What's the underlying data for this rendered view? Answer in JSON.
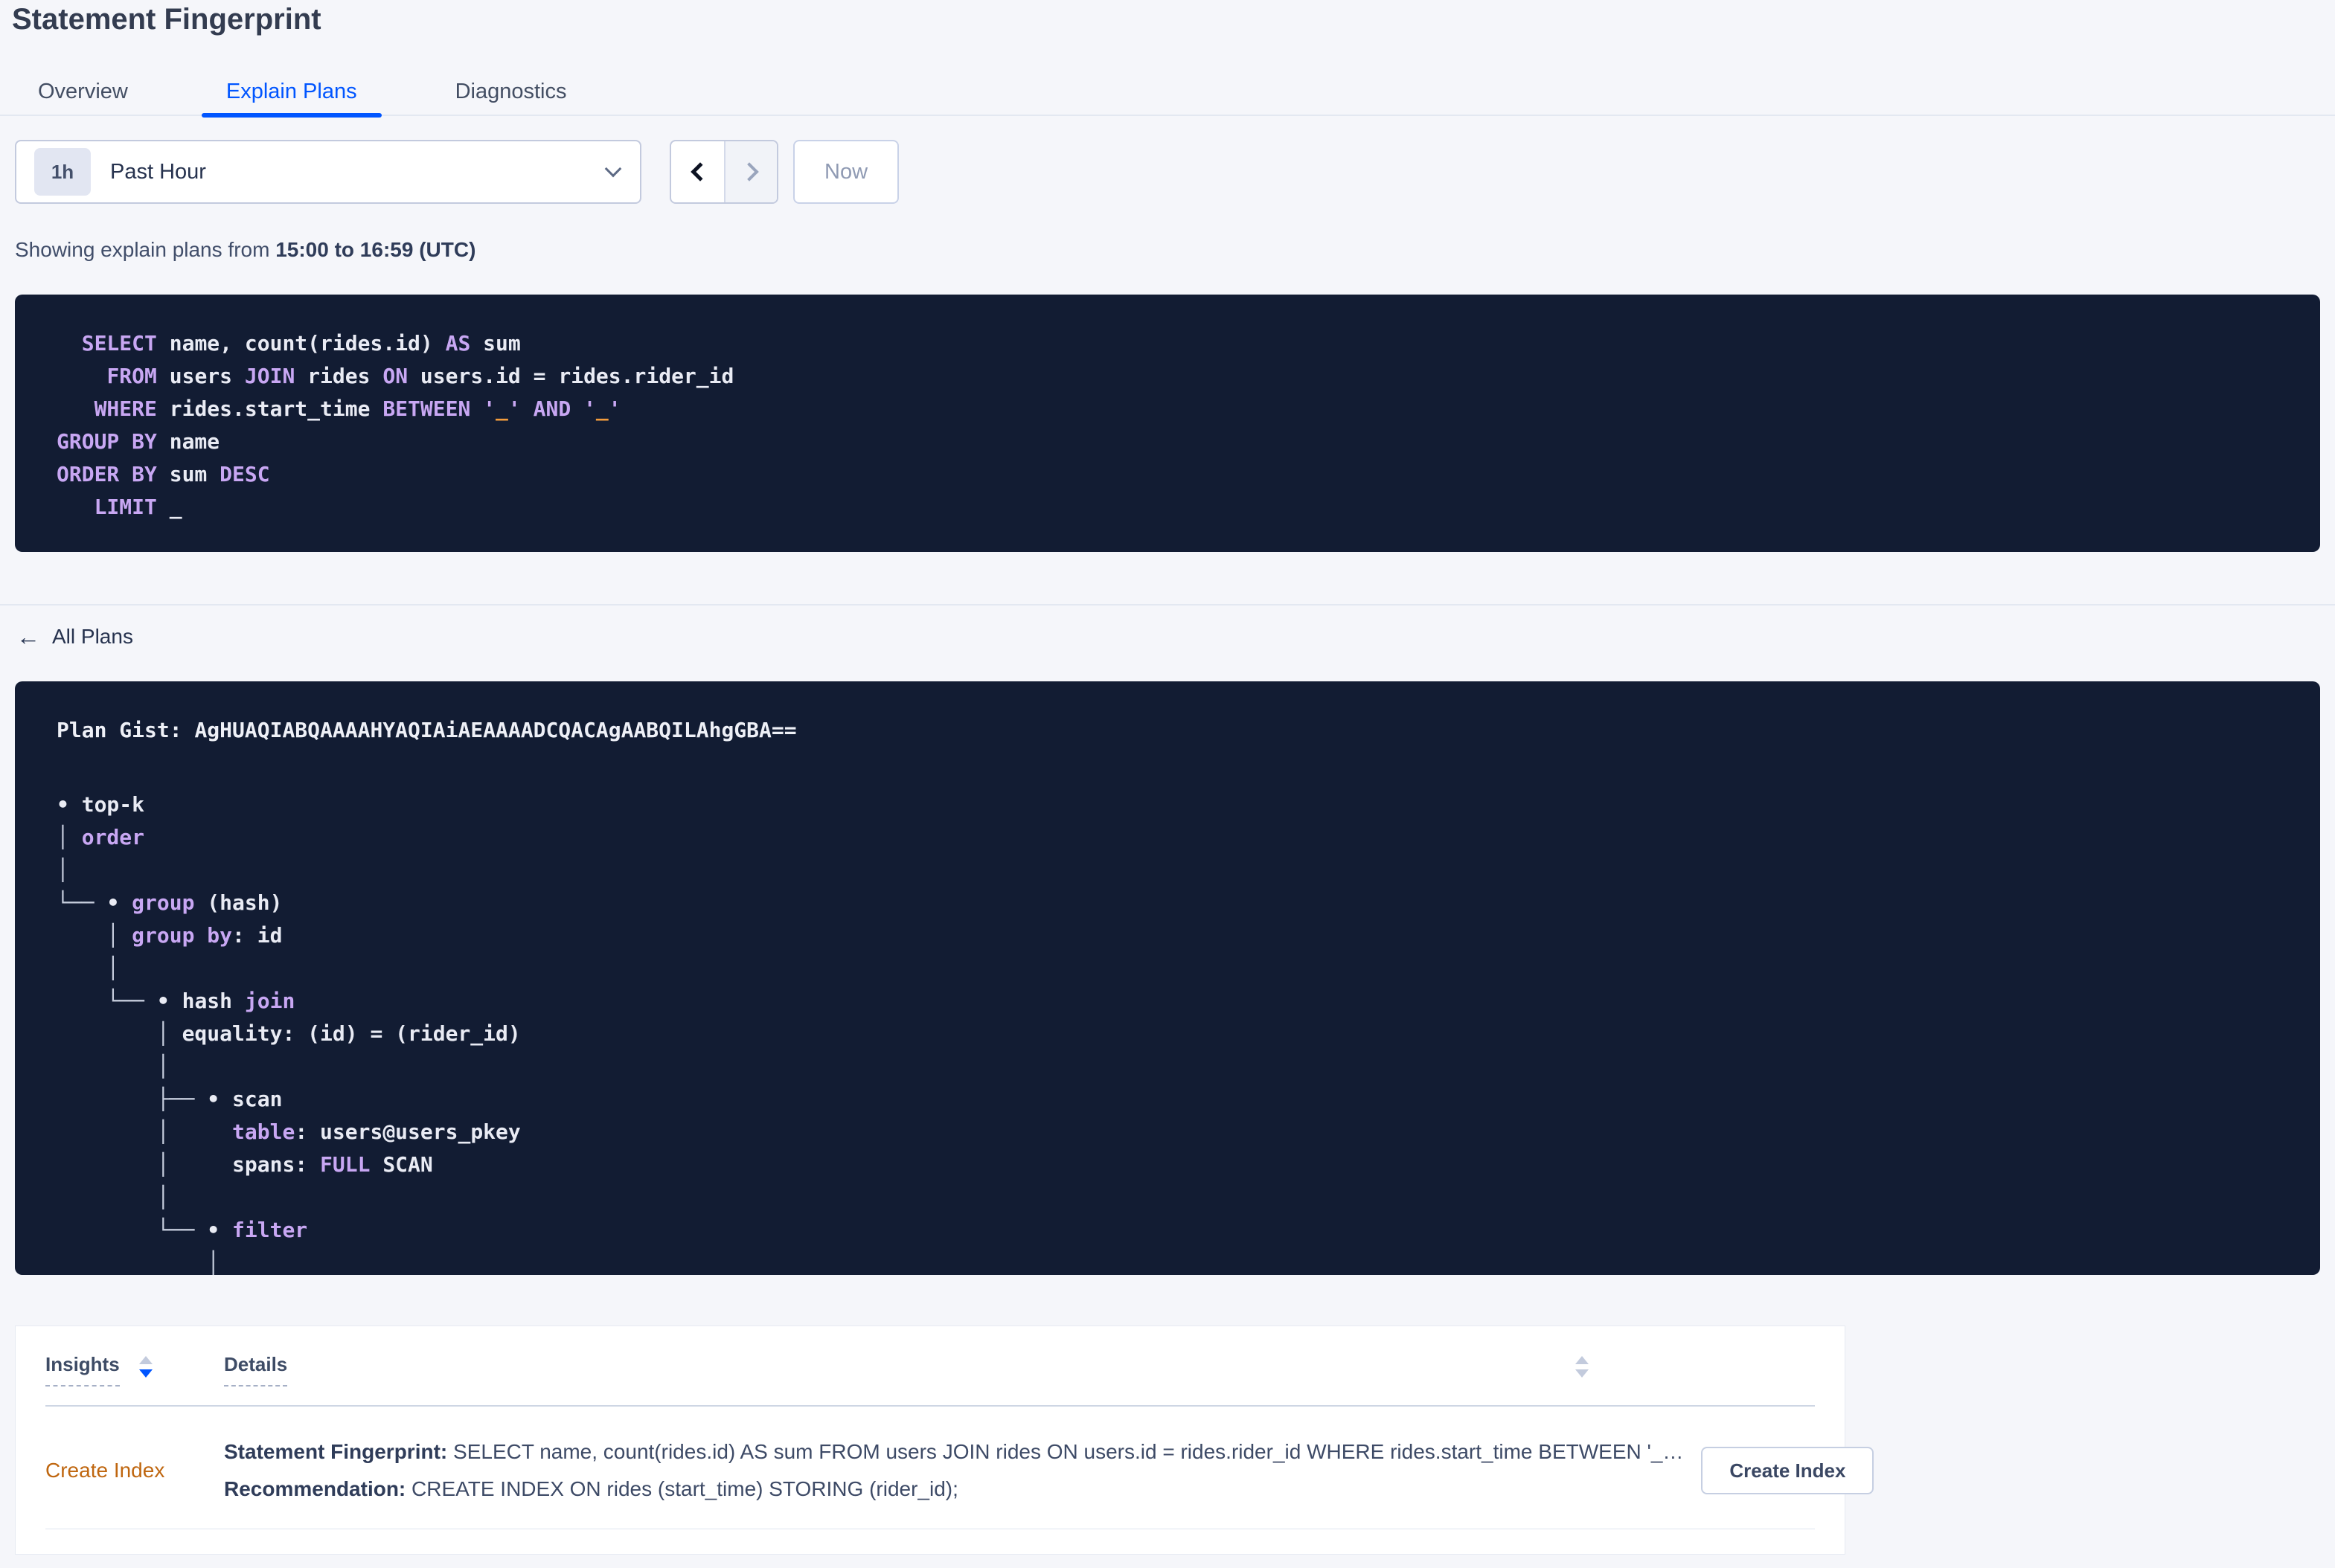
{
  "page": {
    "title": "Statement Fingerprint"
  },
  "tabs": [
    {
      "label": "Overview",
      "active": false
    },
    {
      "label": "Explain Plans",
      "active": true
    },
    {
      "label": "Diagnostics",
      "active": false
    }
  ],
  "time_selector": {
    "badge": "1h",
    "label": "Past Hour",
    "now_label": "Now"
  },
  "subtitle": {
    "prefix": "Showing explain plans from ",
    "bold": "15:00 to 16:59 (UTC)"
  },
  "colors": {
    "accent_blue": "#0055ff",
    "code_background": "#121c33",
    "code_keyword_purple": "#c8a7f3",
    "code_literal_orange": "#f39c3d",
    "insight_orange": "#bf660f",
    "page_background": "#f5f6fa"
  },
  "sql_block": {
    "lines": [
      [
        {
          "t": "  ",
          "c": "p"
        },
        {
          "t": "SELECT",
          "c": "k"
        },
        {
          "t": " name, count(rides.id) ",
          "c": "p"
        },
        {
          "t": "AS",
          "c": "k"
        },
        {
          "t": " sum",
          "c": "p"
        }
      ],
      [
        {
          "t": "    ",
          "c": "p"
        },
        {
          "t": "FROM",
          "c": "k"
        },
        {
          "t": " users ",
          "c": "p"
        },
        {
          "t": "JOIN",
          "c": "k"
        },
        {
          "t": " rides ",
          "c": "p"
        },
        {
          "t": "ON",
          "c": "k"
        },
        {
          "t": " users.id = rides.rider_id",
          "c": "p"
        }
      ],
      [
        {
          "t": "   ",
          "c": "p"
        },
        {
          "t": "WHERE",
          "c": "k"
        },
        {
          "t": " rides.start_time ",
          "c": "p"
        },
        {
          "t": "BETWEEN",
          "c": "k"
        },
        {
          "t": " ",
          "c": "p"
        },
        {
          "t": "'",
          "c": "k"
        },
        {
          "t": "_",
          "c": "o"
        },
        {
          "t": "'",
          "c": "k"
        },
        {
          "t": " ",
          "c": "p"
        },
        {
          "t": "AND",
          "c": "k"
        },
        {
          "t": " ",
          "c": "p"
        },
        {
          "t": "'",
          "c": "k"
        },
        {
          "t": "_",
          "c": "o"
        },
        {
          "t": "'",
          "c": "k"
        }
      ],
      [
        {
          "t": "GROUP BY",
          "c": "k"
        },
        {
          "t": " name",
          "c": "p"
        }
      ],
      [
        {
          "t": "ORDER BY",
          "c": "k"
        },
        {
          "t": " sum ",
          "c": "p"
        },
        {
          "t": "DESC",
          "c": "k"
        }
      ],
      [
        {
          "t": "   ",
          "c": "p"
        },
        {
          "t": "LIMIT",
          "c": "k"
        },
        {
          "t": " _",
          "c": "p"
        }
      ]
    ]
  },
  "all_plans": {
    "label": "All Plans",
    "arrow": "←"
  },
  "plan_block": {
    "gist_label": "Plan Gist: ",
    "gist": "AgHUAQIABQAAAAHYAQIAiAEAAAADCQACAgAABQILAhgGBA==",
    "tree": [
      [
        {
          "t": "• top-k",
          "c": "p"
        }
      ],
      [
        {
          "t": "│ ",
          "c": "t"
        },
        {
          "t": "order",
          "c": "k"
        }
      ],
      [
        {
          "t": "│",
          "c": "t"
        }
      ],
      [
        {
          "t": "└── ",
          "c": "t"
        },
        {
          "t": "• ",
          "c": "p"
        },
        {
          "t": "group",
          "c": "k"
        },
        {
          "t": " (hash)",
          "c": "p"
        }
      ],
      [
        {
          "t": "    ",
          "c": "p"
        },
        {
          "t": "│ ",
          "c": "t"
        },
        {
          "t": "group by",
          "c": "k"
        },
        {
          "t": ": id",
          "c": "p"
        }
      ],
      [
        {
          "t": "    ",
          "c": "p"
        },
        {
          "t": "│",
          "c": "t"
        }
      ],
      [
        {
          "t": "    ",
          "c": "p"
        },
        {
          "t": "└── ",
          "c": "t"
        },
        {
          "t": "• hash ",
          "c": "p"
        },
        {
          "t": "join",
          "c": "k"
        }
      ],
      [
        {
          "t": "        ",
          "c": "p"
        },
        {
          "t": "│ ",
          "c": "t"
        },
        {
          "t": "equality: (id) = (rider_id)",
          "c": "p"
        }
      ],
      [
        {
          "t": "        ",
          "c": "p"
        },
        {
          "t": "│",
          "c": "t"
        }
      ],
      [
        {
          "t": "        ",
          "c": "p"
        },
        {
          "t": "├── ",
          "c": "t"
        },
        {
          "t": "• scan",
          "c": "p"
        }
      ],
      [
        {
          "t": "        ",
          "c": "p"
        },
        {
          "t": "│     ",
          "c": "t"
        },
        {
          "t": "table",
          "c": "k"
        },
        {
          "t": ": users@users_pkey",
          "c": "p"
        }
      ],
      [
        {
          "t": "        ",
          "c": "p"
        },
        {
          "t": "│     ",
          "c": "t"
        },
        {
          "t": "spans: ",
          "c": "p"
        },
        {
          "t": "FULL",
          "c": "k"
        },
        {
          "t": " SCAN",
          "c": "p"
        }
      ],
      [
        {
          "t": "        ",
          "c": "p"
        },
        {
          "t": "│",
          "c": "t"
        }
      ],
      [
        {
          "t": "        ",
          "c": "p"
        },
        {
          "t": "└── ",
          "c": "t"
        },
        {
          "t": "• ",
          "c": "p"
        },
        {
          "t": "filter",
          "c": "k"
        }
      ],
      [
        {
          "t": "            ",
          "c": "p"
        },
        {
          "t": "│",
          "c": "t"
        }
      ]
    ]
  },
  "insights_table": {
    "columns": [
      {
        "label": "Insights"
      },
      {
        "label": "Details"
      }
    ],
    "row": {
      "insight": "Create Index",
      "fingerprint_label": "Statement Fingerprint:",
      "fingerprint": " SELECT name, count(rides.id) AS sum FROM users JOIN rides ON users.id = rides.rider_id WHERE rides.start_time BETWEEN '_…",
      "recommendation_label": "Recommendation:",
      "recommendation": " CREATE INDEX ON rides (start_time) STORING (rider_id);",
      "action_label": "Create Index"
    }
  }
}
